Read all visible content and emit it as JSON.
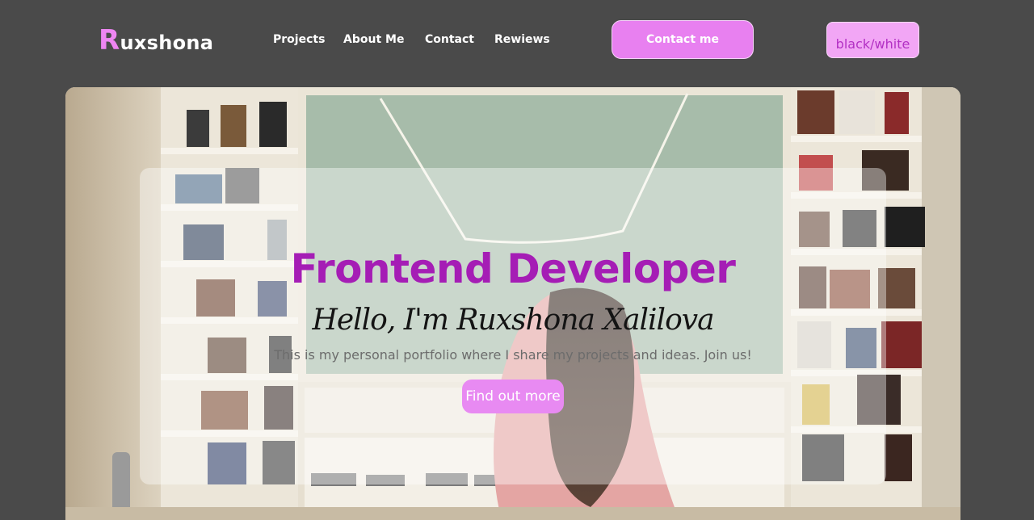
{
  "header": {
    "logo_initial": "R",
    "logo_rest": "uxshona",
    "nav": [
      "Projects",
      "About Me",
      "Contact",
      "Rewiews"
    ],
    "contact_button": "Contact me",
    "theme_button": "black/white"
  },
  "hero": {
    "title": "Frontend Developer",
    "greeting": "Hello, I'm Ruxshona Xalilova",
    "description": "This is my personal portfolio where I share my projects and ideas. Join us!",
    "cta": "Find out more"
  },
  "colors": {
    "background": "#4a4a4a",
    "accent": "#e880f0",
    "title": "#a51db5"
  }
}
